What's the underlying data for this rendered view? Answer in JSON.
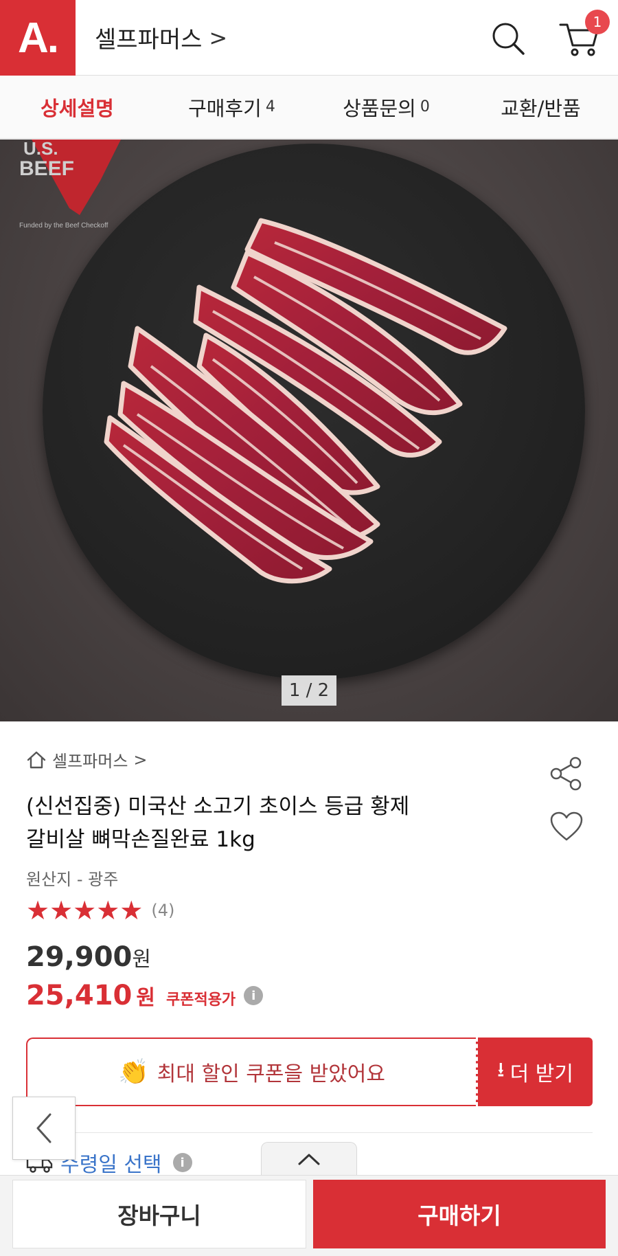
{
  "header": {
    "logo_text": "A.",
    "store_name": "셀프파머스",
    "store_chevron": ">",
    "cart_badge": "1"
  },
  "tabs": [
    {
      "label": "상세설명",
      "count": ""
    },
    {
      "label": "구매후기",
      "count": "4"
    },
    {
      "label": "상품문의",
      "count": "0"
    },
    {
      "label": "교환/반품",
      "count": ""
    }
  ],
  "hero": {
    "page_indicator": "1 / 2",
    "watermark_text": "U.S. BEEF",
    "watermark_subtext": "Funded by the Beef Checkoff"
  },
  "product": {
    "breadcrumb_store": "셀프파머스",
    "breadcrumb_chevron": ">",
    "title_line1": "(신선집중) 미국산 소고기 초이스 등급 황제",
    "title_line2": "갈비살 뼈막손질완료 1kg",
    "origin": "원산지 - 광주",
    "stars": "★★★★★",
    "rating_count": "(4)",
    "price_original": "29,900",
    "price_original_unit": "원",
    "price_sale": "25,410",
    "price_sale_unit": "원",
    "coupon_price_label": "쿠폰적용가",
    "info_mark": "i"
  },
  "coupon": {
    "emoji": "👏",
    "message": "최대 할인 쿠폰을 받았어요",
    "more_arrow": "⭳",
    "more_label": "더 받기"
  },
  "delivery": {
    "label": "수령일 선택",
    "info_mark": "i"
  },
  "bottom_bar": {
    "cart_label": "장바구니",
    "buy_label": "구매하기"
  },
  "colors": {
    "brand_red": "#d92f35",
    "link_blue": "#3a74c9"
  }
}
